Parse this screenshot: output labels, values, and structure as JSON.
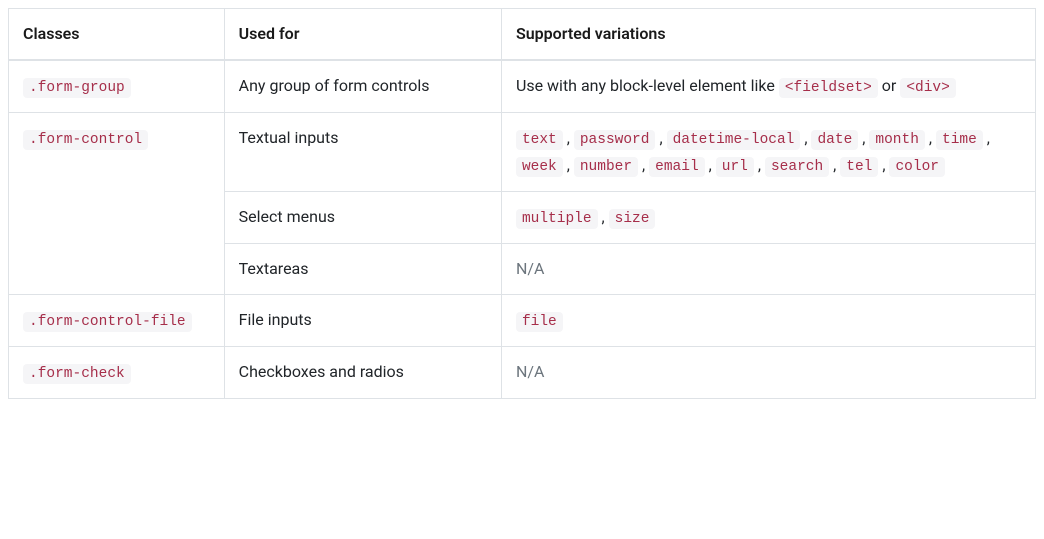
{
  "headers": {
    "classes": "Classes",
    "used_for": "Used for",
    "variations": "Supported variations"
  },
  "rows": {
    "form_group": {
      "class": ".form-group",
      "used_for": "Any group of form controls",
      "variation_prefix": "Use with any block-level element like ",
      "variation_sep": " or ",
      "codes": [
        "<fieldset>",
        "<div>"
      ]
    },
    "form_control_text": {
      "class": ".form-control",
      "used_for": "Textual inputs",
      "codes": [
        "text",
        "password",
        "datetime-local",
        "date",
        "month",
        "time",
        "week",
        "number",
        "email",
        "url",
        "search",
        "tel",
        "color"
      ]
    },
    "form_control_select": {
      "used_for": "Select menus",
      "codes": [
        "multiple",
        "size"
      ]
    },
    "form_control_textarea": {
      "used_for": "Textareas",
      "na": "N/A"
    },
    "form_control_file": {
      "class": ".form-control-file",
      "used_for": "File inputs",
      "codes": [
        "file"
      ]
    },
    "form_check": {
      "class": ".form-check",
      "used_for": "Checkboxes and radios",
      "na": "N/A"
    }
  }
}
